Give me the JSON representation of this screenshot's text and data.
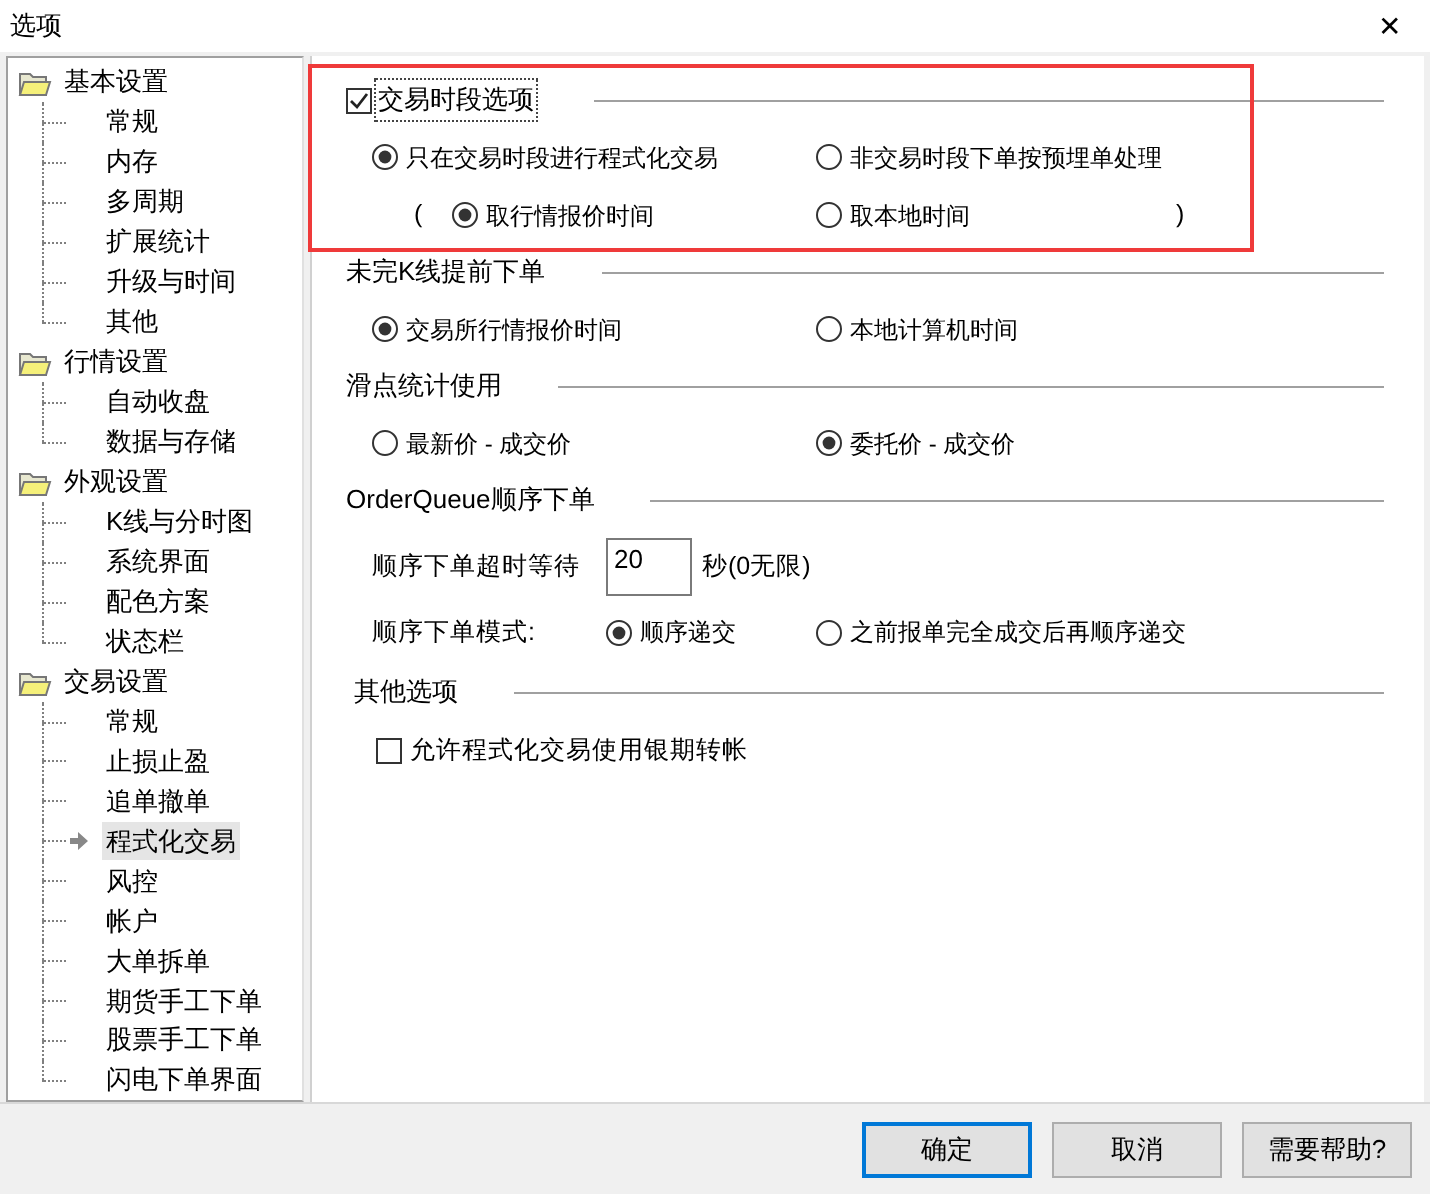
{
  "window": {
    "title": "选项",
    "close": "✕"
  },
  "tree": [
    {
      "label": "基本设置",
      "expanded": true,
      "children": [
        {
          "label": "常规",
          "selected": false
        },
        {
          "label": "内存",
          "selected": false
        },
        {
          "label": "多周期",
          "selected": false
        },
        {
          "label": "扩展统计",
          "selected": false
        },
        {
          "label": "升级与时间",
          "selected": false
        },
        {
          "label": "其他",
          "selected": false
        }
      ]
    },
    {
      "label": "行情设置",
      "expanded": true,
      "children": [
        {
          "label": "自动收盘",
          "selected": false
        },
        {
          "label": "数据与存储",
          "selected": false
        }
      ]
    },
    {
      "label": "外观设置",
      "expanded": true,
      "children": [
        {
          "label": "K线与分时图",
          "selected": false
        },
        {
          "label": "系统界面",
          "selected": false
        },
        {
          "label": "配色方案",
          "selected": false
        },
        {
          "label": "状态栏",
          "selected": false
        }
      ]
    },
    {
      "label": "交易设置",
      "expanded": true,
      "children": [
        {
          "label": "常规",
          "selected": false
        },
        {
          "label": "止损止盈",
          "selected": false
        },
        {
          "label": "追单撤单",
          "selected": false
        },
        {
          "label": "程式化交易",
          "selected": true
        },
        {
          "label": "风控",
          "selected": false
        },
        {
          "label": "帐户",
          "selected": false
        },
        {
          "label": "大单拆单",
          "selected": false
        },
        {
          "label": "期货手工下单",
          "selected": false
        },
        {
          "label": "股票手工下单",
          "selected": false
        },
        {
          "label": "闪电下单界面",
          "selected": false
        }
      ]
    }
  ],
  "sections": [
    {
      "title": "交易时段选项",
      "kind": "checkbox_heading",
      "checked": true,
      "rows": [
        {
          "kind": "radios",
          "options": [
            {
              "label": "只在交易时段进行程式化交易",
              "selected": true
            },
            {
              "label": "非交易时段下单按预埋单处理",
              "selected": false
            }
          ]
        },
        {
          "kind": "radios",
          "prefix": "(",
          "suffix": ")",
          "options": [
            {
              "label": "取行情报价时间",
              "selected": true
            },
            {
              "label": "取本地时间",
              "selected": false
            }
          ]
        }
      ]
    },
    {
      "title": "未完K线提前下单",
      "kind": "heading",
      "rows": [
        {
          "kind": "radios",
          "options": [
            {
              "label": "交易所行情报价时间",
              "selected": true
            },
            {
              "label": "本地计算机时间",
              "selected": false
            }
          ]
        }
      ]
    },
    {
      "title": "滑点统计使用",
      "kind": "heading",
      "rows": [
        {
          "kind": "radios",
          "options": [
            {
              "label": "最新价 - 成交价",
              "selected": false
            },
            {
              "label": "委托价 - 成交价",
              "selected": true
            }
          ]
        }
      ]
    },
    {
      "title": "OrderQueue顺序下单",
      "kind": "heading",
      "rows": [
        {
          "kind": "input",
          "label": "顺序下单超时等待",
          "value": "20",
          "unit": "秒(0无限)"
        },
        {
          "kind": "labeled_radios",
          "label": "顺序下单模式:",
          "options": [
            {
              "label": "顺序递交",
              "selected": true
            },
            {
              "label": "之前报单完全成交后再顺序递交",
              "selected": false
            }
          ]
        }
      ]
    },
    {
      "title": "其他选项",
      "kind": "heading",
      "rows": [
        {
          "kind": "checkbox",
          "label": "允许程式化交易使用银期转帐",
          "checked": false
        }
      ]
    }
  ],
  "buttons": [
    {
      "label": "确定",
      "default": true
    },
    {
      "label": "取消",
      "default": false
    },
    {
      "label": "需要帮助?",
      "default": false
    }
  ]
}
